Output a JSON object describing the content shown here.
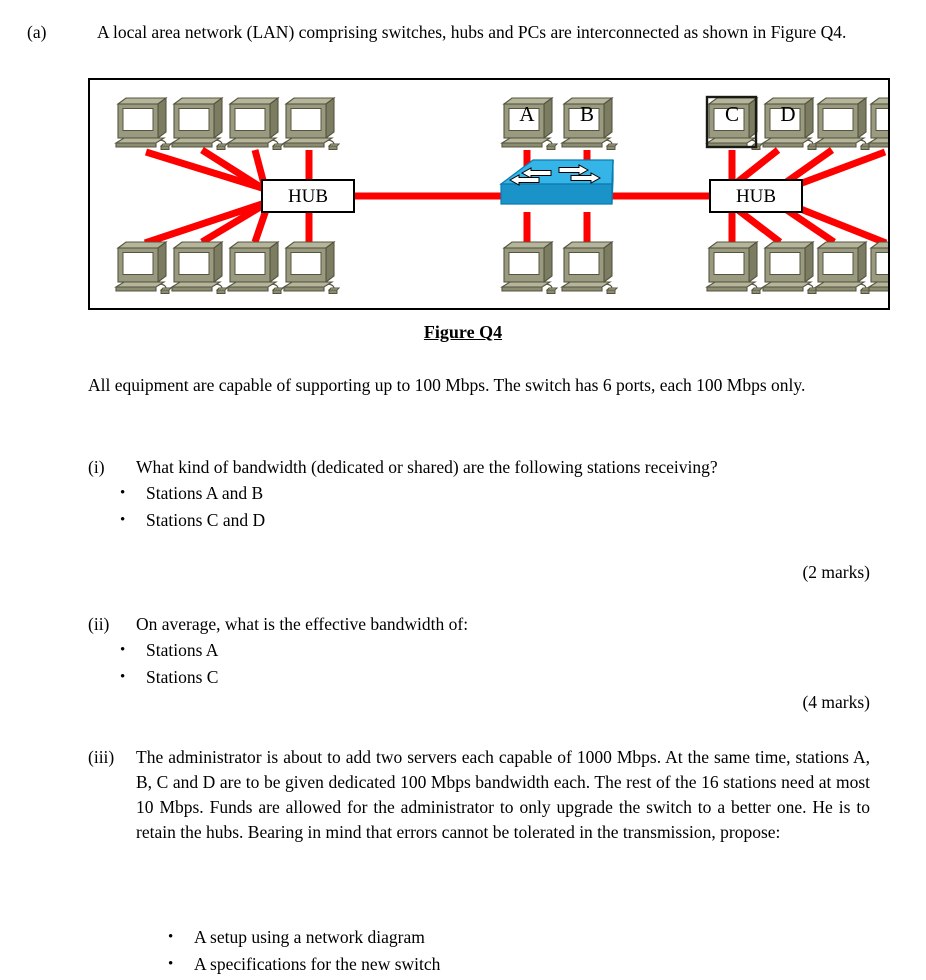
{
  "question": {
    "part_label": "(a)",
    "intro_text": "A local area network (LAN) comprising switches, hubs and PCs are interconnected as shown in Figure Q4."
  },
  "figure": {
    "caption": "Figure Q4",
    "hub_left_label": "HUB",
    "hub_right_label": "HUB",
    "station_a_label": "A",
    "station_b_label": "B",
    "station_c_label": "C",
    "station_d_label": "D",
    "colors": {
      "link": "#ff0000",
      "switch_top": "#29abe2",
      "switch_side": "#0b7cb0",
      "switch_front": "#1a93c9",
      "pc_body": "#9a9a80",
      "pc_body_light": "#b5b59b",
      "pc_body_dark": "#6e6e58",
      "pc_screen": "#ffffff",
      "frame_border": "#000000",
      "hub_fill": "#ffffff"
    }
  },
  "body_paragraph": "All equipment are capable of supporting up to 100 Mbps. The switch has 6 ports, each 100 Mbps only.",
  "sections": [
    {
      "label": "(i)",
      "text": "What kind of bandwidth (dedicated or shared) are the following stations receiving?",
      "bullets": [
        "Stations A and B",
        "Stations C and D"
      ],
      "marks": "(2 marks)"
    },
    {
      "label": "(ii)",
      "text": "On average, what is the effective bandwidth of:",
      "bullets": [
        "Stations A",
        "Stations C"
      ],
      "marks": "(4 marks)"
    },
    {
      "label": "(iii)",
      "text": "The administrator is about to add two servers each capable of 1000 Mbps. At the same time, stations A, B, C and D are to be given dedicated 100 Mbps bandwidth each. The rest of the 16 stations need at most 10 Mbps. Funds are allowed for the administrator to only upgrade the switch to a better one. He is to retain the hubs. Bearing in mind that errors cannot be tolerated in the transmission, propose:",
      "bullets": [
        "A setup using a network diagram",
        "A specifications for the new switch"
      ]
    }
  ]
}
